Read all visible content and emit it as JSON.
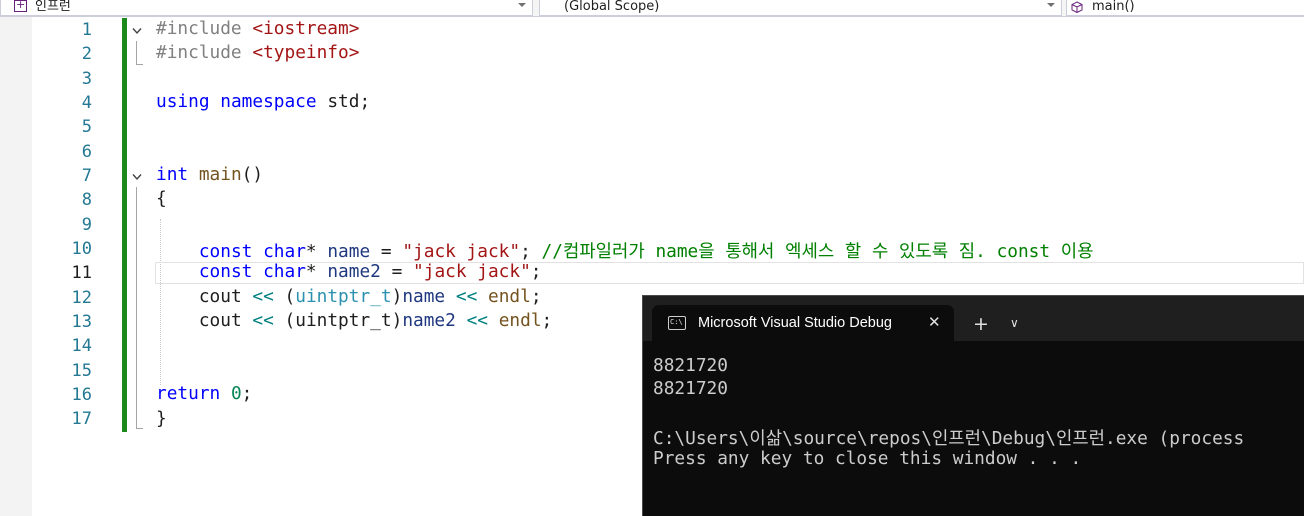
{
  "navbar": {
    "project": "인프런",
    "scope": "(Global Scope)",
    "member": "main()"
  },
  "editor": {
    "line_numbers": [
      "1",
      "2",
      "3",
      "4",
      "5",
      "6",
      "7",
      "8",
      "9",
      "10",
      "11",
      "12",
      "13",
      "14",
      "15",
      "16",
      "17"
    ],
    "current_line": "11",
    "code": {
      "l1_directive": "#include",
      "l1_header": "<iostream>",
      "l2_directive": "#include",
      "l2_header": "<typeinfo>",
      "l4_kw_using": "using",
      "l4_kw_namespace": "namespace",
      "l4_rest": "std;",
      "l7_kw": "int",
      "l7_fn": "main",
      "l7_parens": "()",
      "l8_brace": "{",
      "l10_kw_const": "const",
      "l10_kw_char": "char",
      "l10_star": "*",
      "l10_var": "name",
      "l10_eq": "=",
      "l10_str": "\"jack jack\"",
      "l10_semi": ";",
      "l10_comment": "//컴파일러가 name을 통해서 엑세스 할 수 있도록 짐. const 이용",
      "l11_kw_const": "const",
      "l11_kw_char": "char",
      "l11_star": "*",
      "l11_var": "name2",
      "l11_eq": "=",
      "l11_str": "\"jack jack\"",
      "l11_semi": ";",
      "l12_cout": "cout",
      "l12_op1": "<<",
      "l12_paren_open": "(",
      "l12_type": "uintptr_t",
      "l12_paren_close": ")",
      "l12_var": "name",
      "l12_op2": "<<",
      "l12_endl": "endl",
      "l12_semi": ";",
      "l13_cout": "cout",
      "l13_op1": "<<",
      "l13_paren_open": "(",
      "l13_type": "uintptr_t",
      "l13_paren_close": ")",
      "l13_var": "name2",
      "l13_op2": "<<",
      "l13_endl": "endl",
      "l13_semi": ";",
      "l16_kw": "return",
      "l16_num": "0",
      "l16_semi": ";",
      "l17_brace": "}"
    }
  },
  "console": {
    "tab_title": "Microsoft Visual Studio Debug",
    "close_glyph": "✕",
    "new_tab_glyph": "+",
    "dropdown_glyph": "∨",
    "icon_text": "C:\\",
    "output": [
      "8821720",
      "8821720",
      "",
      "C:\\Users\\이삶\\source\\repos\\인프런\\Debug\\인프런.exe (process",
      "Press any key to close this window . . ."
    ]
  },
  "colors": {
    "keyword": "#0000ff",
    "string": "#a31515",
    "comment": "#008000",
    "type": "#2b91af",
    "change_bar": "#1b8a1b",
    "console_bg": "#0c0c0c"
  }
}
